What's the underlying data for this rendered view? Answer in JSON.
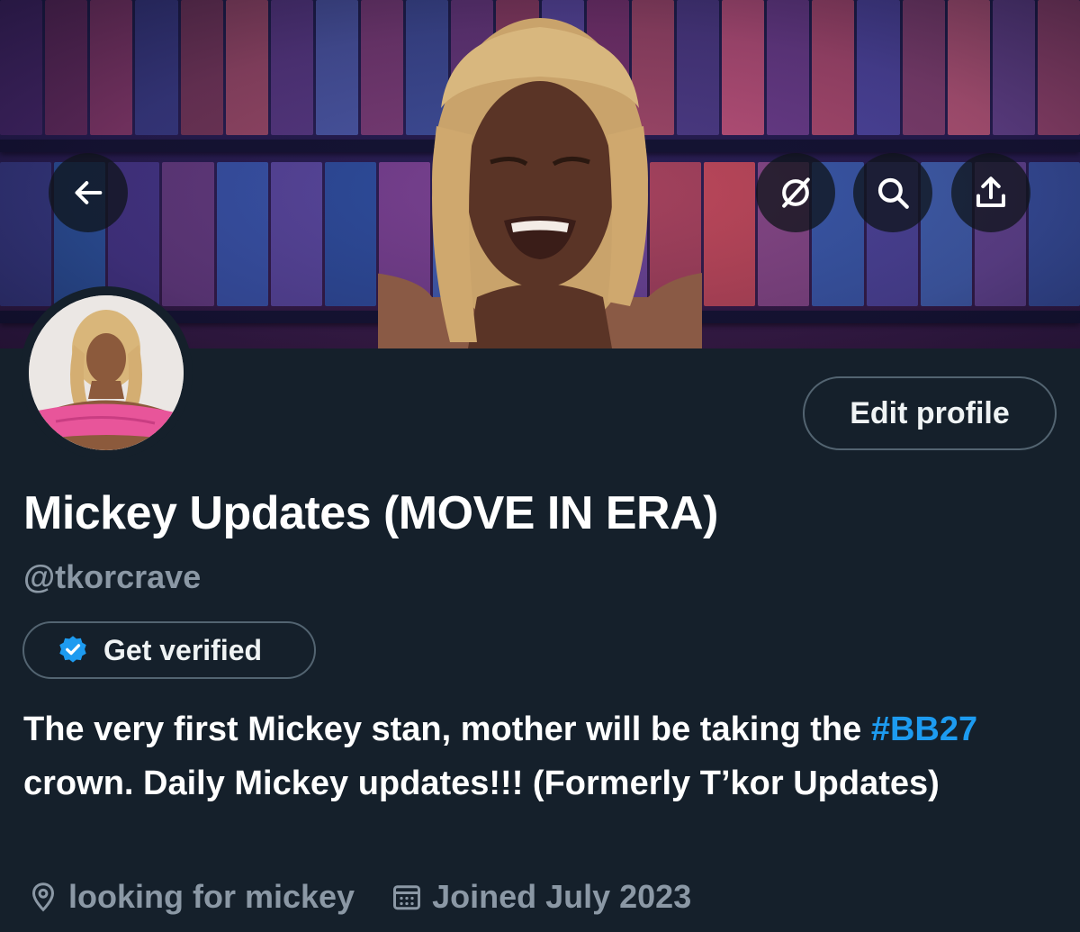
{
  "header": {
    "back_icon": "arrow-left-icon",
    "grok_icon": "grok-slash-circle-icon",
    "search_icon": "search-icon",
    "share_icon": "share-upload-icon"
  },
  "profile": {
    "display_name": "Mickey Updates (MOVE IN ERA)",
    "handle": "@tkorcrave",
    "edit_profile_label": "Edit profile",
    "get_verified_label": "Get verified",
    "bio_part1": "The very first Mickey stan, mother will be taking the ",
    "bio_hashtag": "#BB27",
    "bio_part2": " crown. Daily Mickey updates!!! (Formerly T’kor Updates)",
    "location": "looking for mickey",
    "joined": "Joined July 2023"
  },
  "colors": {
    "background": "#15202b",
    "accent": "#1d9bf0",
    "secondary_text": "#8b98a5",
    "border": "#536471"
  }
}
